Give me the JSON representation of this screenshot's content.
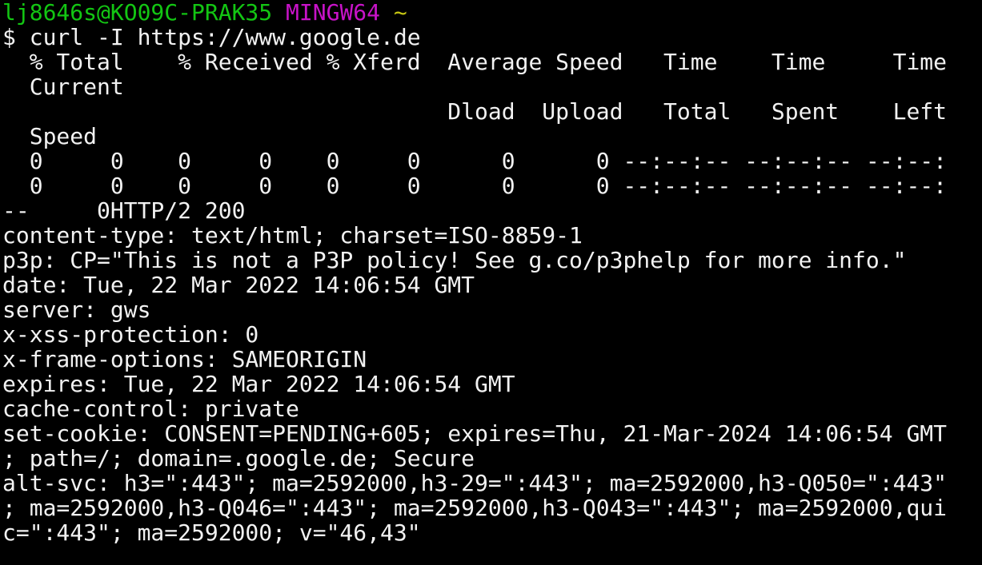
{
  "prompt": {
    "user_host": "lj8646s@KO09C-PRAK35",
    "shell": "MINGW64",
    "cwd": "~",
    "symbol": "$",
    "command": "curl -I https://www.google.de",
    "colors": {
      "user_host": "#13c613",
      "shell": "#c813c8",
      "cwd": "#c8c813",
      "text": "#f2f2f2",
      "background": "#000000"
    }
  },
  "progress": {
    "header_1": "  % Total    % Received % Xferd  Average Speed   Time    Time     Time  ",
    "header_1b": "  Current",
    "header_2": "                                 Dload  Upload   Total   Spent    Left  ",
    "header_2b": "  Speed",
    "row_1": "  0     0    0     0    0     0      0      0 --:--:-- --:--:-- --:--:",
    "row_2": "  0     0    0     0    0     0      0      0 --:--:-- --:--:-- --:--:",
    "row_2_tail": "--     0HTTP/2 200"
  },
  "response_lines": [
    "content-type: text/html; charset=ISO-8859-1",
    "p3p: CP=\"This is not a P3P policy! See g.co/p3phelp for more info.\"",
    "date: Tue, 22 Mar 2022 14:06:54 GMT",
    "server: gws",
    "x-xss-protection: 0",
    "x-frame-options: SAMEORIGIN",
    "expires: Tue, 22 Mar 2022 14:06:54 GMT",
    "cache-control: private",
    "set-cookie: CONSENT=PENDING+605; expires=Thu, 21-Mar-2024 14:06:54 GMT",
    "; path=/; domain=.google.de; Secure",
    "alt-svc: h3=\":443\"; ma=2592000,h3-29=\":443\"; ma=2592000,h3-Q050=\":443\"",
    "; ma=2592000,h3-Q046=\":443\"; ma=2592000,h3-Q043=\":443\"; ma=2592000,qui",
    "c=\":443\"; ma=2592000; v=\"46,43\""
  ]
}
